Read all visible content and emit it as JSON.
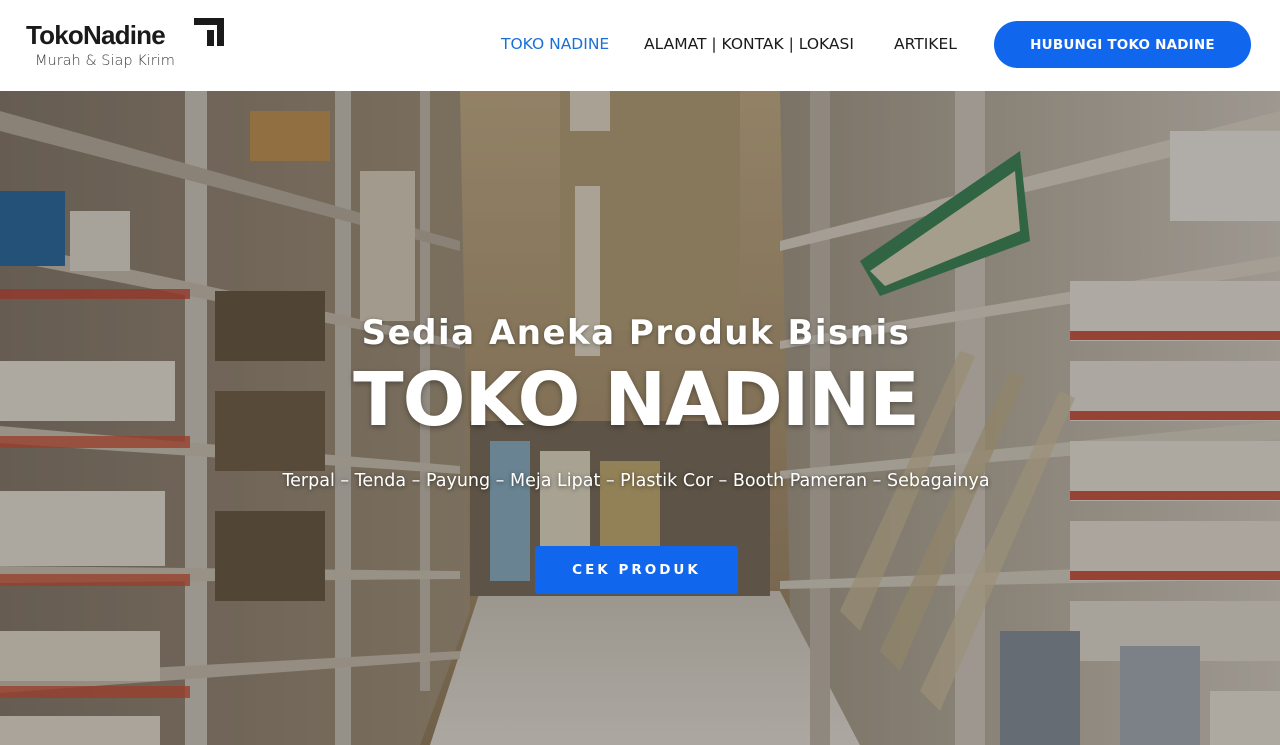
{
  "brand": {
    "name": "TokoNadine",
    "tagline": "Murah & Siap Kirim",
    "logo_icon": "arrow-mark-icon"
  },
  "nav": {
    "items": [
      {
        "label": "TOKO NADINE",
        "active": true
      },
      {
        "label": "ALAMAT | KONTAK | LOKASI",
        "active": false
      },
      {
        "label": "ARTIKEL",
        "active": false
      }
    ],
    "cta_label": "HUBUNGI TOKO NADINE"
  },
  "hero": {
    "subtitle": "Sedia Aneka Produk Bisnis",
    "title": "TOKO NADINE",
    "tagline": "Terpal – Tenda – Payung – Meja Lipat – Plastik Cor – Booth Pameran – Sebagainya",
    "button_label": "CEK PRODUK"
  },
  "colors": {
    "accent": "#1166ee",
    "nav_active": "#1a6fd8",
    "text_dark": "#1a1a1a",
    "header_bg": "#ffffff"
  }
}
